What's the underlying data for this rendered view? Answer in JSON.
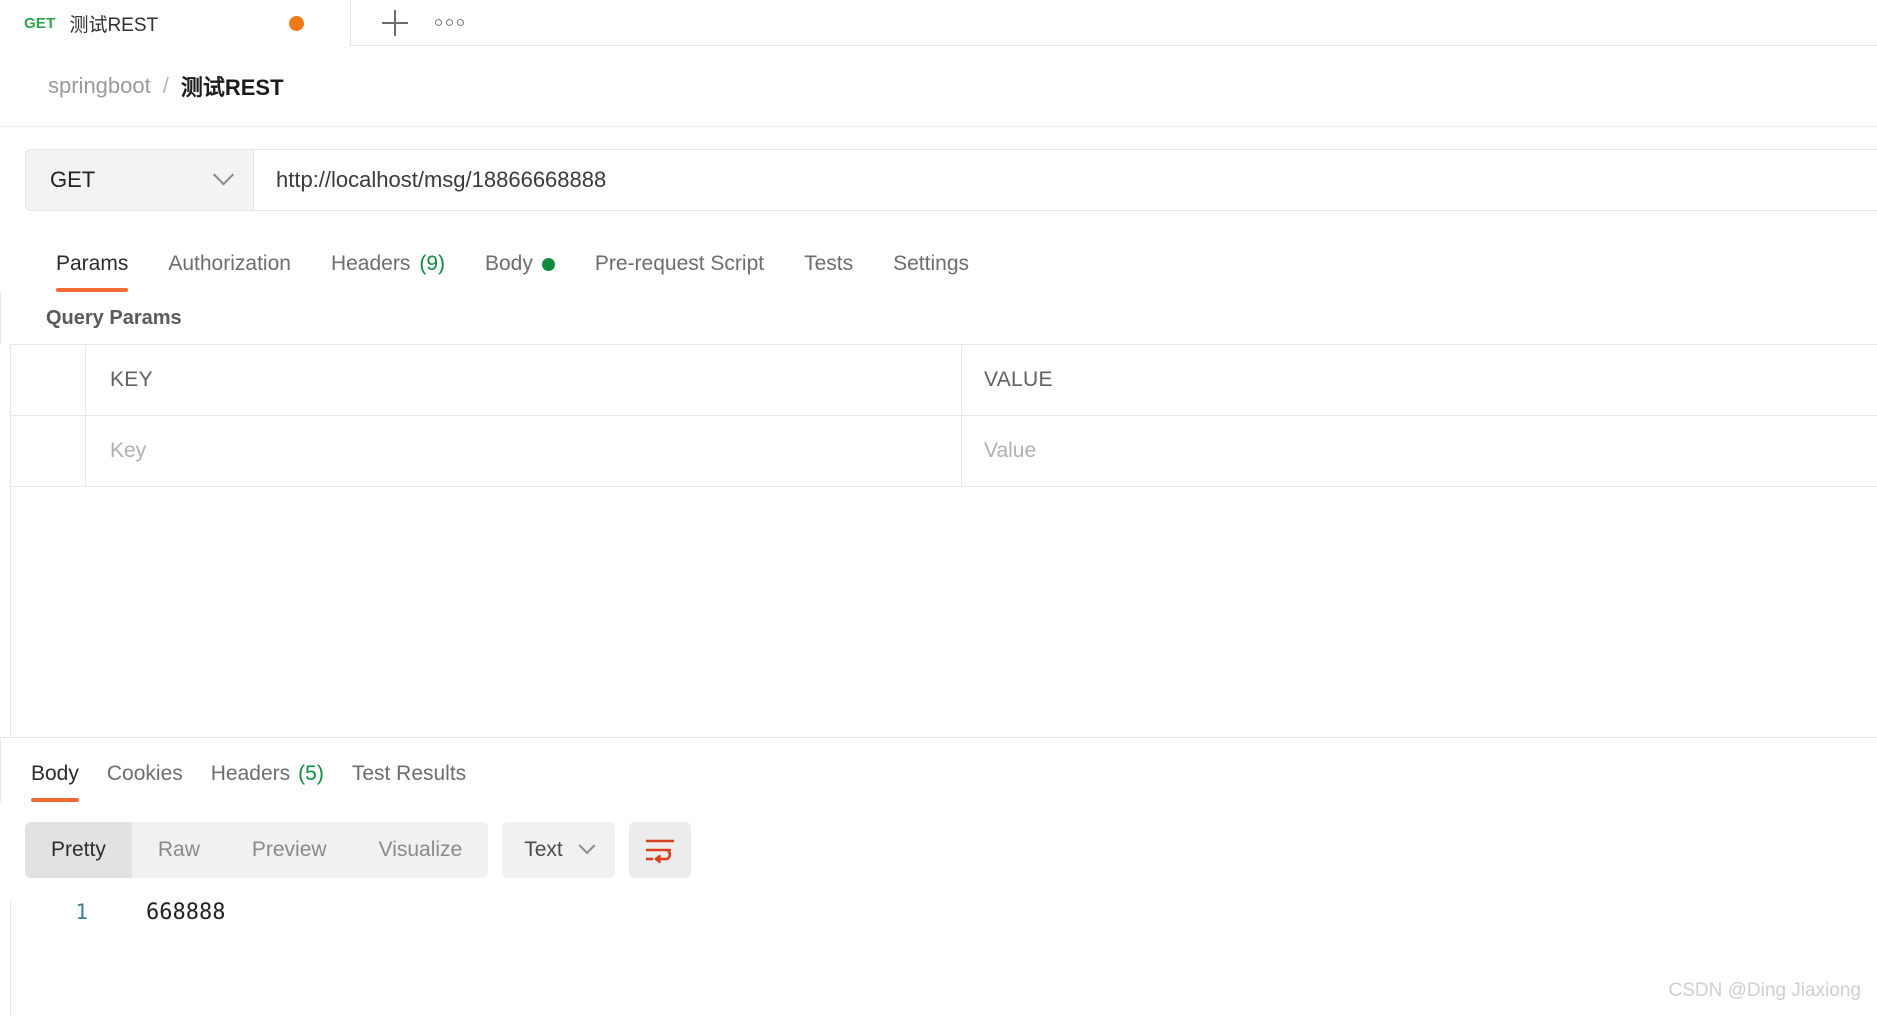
{
  "tab": {
    "method": "GET",
    "title": "测试REST",
    "unsaved_indicator": "unsaved-dot",
    "new_tab_icon": "plus-icon",
    "more_icon": "ooo-icon"
  },
  "breadcrumb": {
    "collection": "springboot",
    "separator": "/",
    "current": "测试REST"
  },
  "url_bar": {
    "method": "GET",
    "method_chevron_icon": "chevron-down-icon",
    "url": "http://localhost/msg/18866668888"
  },
  "request_tabs": [
    {
      "label": "Params",
      "active": true
    },
    {
      "label": "Authorization",
      "active": false
    },
    {
      "label": "Headers",
      "count": "(9)",
      "active": false
    },
    {
      "label": "Body",
      "dot": true,
      "active": false
    },
    {
      "label": "Pre-request Script",
      "active": false
    },
    {
      "label": "Tests",
      "active": false
    },
    {
      "label": "Settings",
      "active": false
    }
  ],
  "query_params": {
    "title": "Query Params",
    "columns": {
      "key": "KEY",
      "value": "VALUE"
    },
    "rows": [
      {
        "key_placeholder": "Key",
        "value_placeholder": "Value"
      }
    ]
  },
  "response_tabs": [
    {
      "label": "Body",
      "active": true
    },
    {
      "label": "Cookies",
      "active": false
    },
    {
      "label": "Headers",
      "count": "(5)",
      "active": false
    },
    {
      "label": "Test Results",
      "active": false
    }
  ],
  "body_toolbar": {
    "views": [
      {
        "label": "Pretty",
        "active": true
      },
      {
        "label": "Raw",
        "active": false
      },
      {
        "label": "Preview",
        "active": false
      },
      {
        "label": "Visualize",
        "active": false
      }
    ],
    "format": "Text",
    "format_chevron_icon": "chevron-down-icon",
    "wrap_icon": "word-wrap-icon"
  },
  "response_body": {
    "lines": [
      {
        "number": "1",
        "text": "668888"
      }
    ]
  },
  "watermark": "CSDN @Ding Jiaxiong",
  "colors": {
    "accent": "#f26b32",
    "method_green": "#2ea44f",
    "count_green": "#0f8a3f",
    "unsaved_orange": "#f07818",
    "line_number_blue": "#3d7f9a"
  }
}
